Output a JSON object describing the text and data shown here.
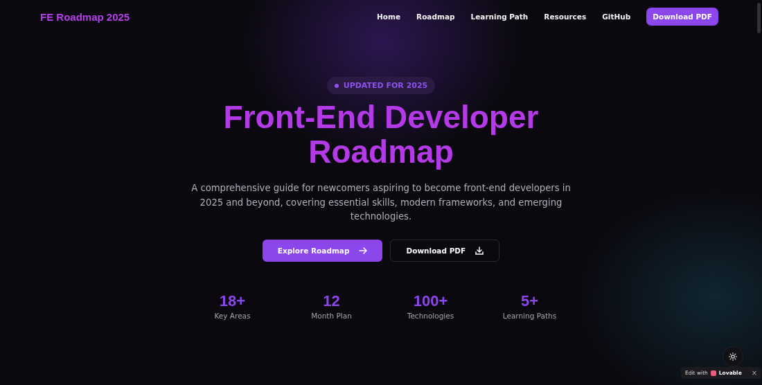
{
  "nav": {
    "brand": "FE Roadmap 2025",
    "links": [
      "Home",
      "Roadmap",
      "Learning Path",
      "Resources",
      "GitHub"
    ],
    "cta": "Download PDF"
  },
  "hero": {
    "badge": "UPDATED FOR 2025",
    "title_lines": [
      "Front-End Developer",
      "Roadmap"
    ],
    "description": "A comprehensive guide for newcomers aspiring to become front-end developers in 2025 and beyond, covering essential skills, modern frameworks, and emerging technologies.",
    "buttons": [
      {
        "kind": "primary",
        "label": "Explore Roadmap"
      },
      {
        "kind": "secondary",
        "label": "Download PDF"
      }
    ]
  },
  "stats": [
    {
      "value": "18+",
      "label": "Key Areas"
    },
    {
      "value": "12",
      "label": "Month Plan"
    },
    {
      "value": "100+",
      "label": "Technologies"
    },
    {
      "value": "5+",
      "label": "Learning Paths"
    }
  ],
  "edit_badge": {
    "prefix": "Edit with",
    "brand": "Lovable",
    "close": "×"
  }
}
